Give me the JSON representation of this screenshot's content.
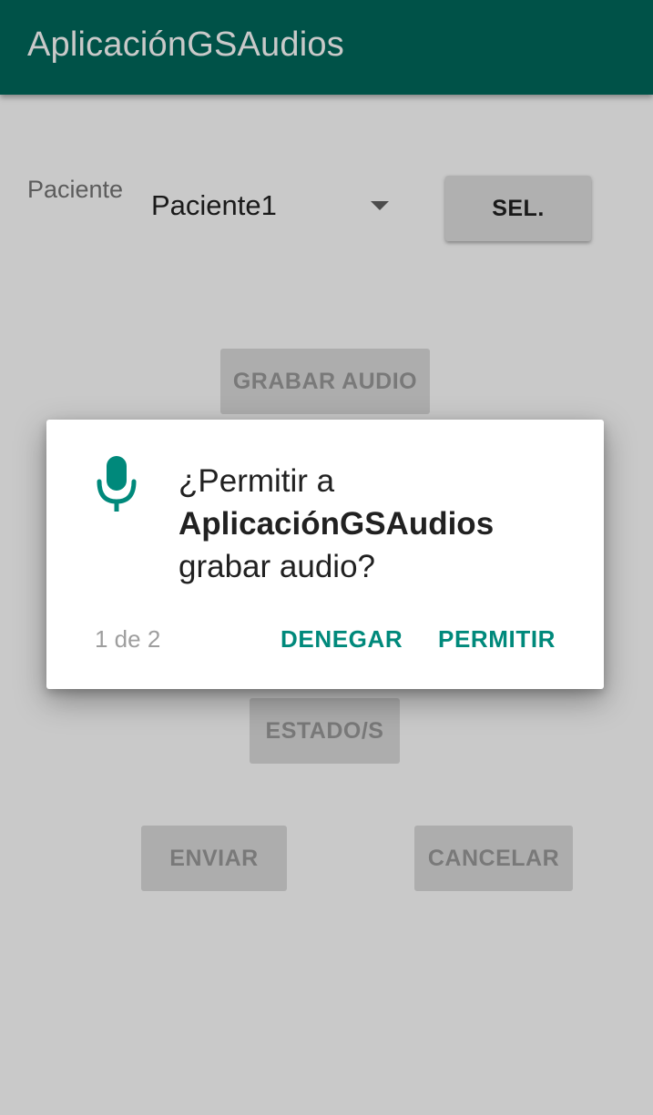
{
  "app_bar": {
    "title": "AplicaciónGSAudios"
  },
  "form": {
    "patient_label": "Paciente",
    "patient_selected": "Paciente1",
    "select_button": "SEL.",
    "record_button": "GRABAR AUDIO",
    "status_button": "ESTADO/S",
    "send_button": "ENVIAR",
    "cancel_button": "CANCELAR"
  },
  "permission_dialog": {
    "icon": "microphone-icon",
    "line1": "¿Permitir a",
    "app_name": "AplicaciónGSAudios",
    "line3": "grabar audio?",
    "counter": "1 de 2",
    "deny": "DENEGAR",
    "allow": "PERMITIR"
  },
  "colors": {
    "primary": "#00695c",
    "accent": "#00897b",
    "scrim": "rgba(0,0,0,0.21)"
  }
}
